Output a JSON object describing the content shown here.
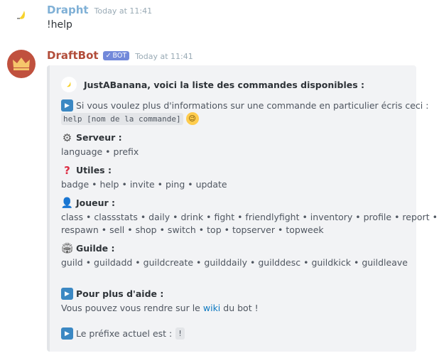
{
  "messages": [
    {
      "author": "Drapht",
      "timestamp": "Today at 11:41",
      "text": "!help",
      "avatar_icon": "banana-icon"
    },
    {
      "author": "DraftBot",
      "bot_tag": "BOT",
      "timestamp": "Today at 11:41",
      "avatar_icon": "crown-icon"
    }
  ],
  "embed": {
    "author": "JustABanana, voici la liste des commandes disponibles :",
    "intro": "Si vous voulez plus d'informations sur une commande en particulier écris ceci :",
    "intro_code": "help [nom de la commande]",
    "sections": [
      {
        "icon": "gear-icon",
        "title": "Serveur :",
        "commands": "language • prefix"
      },
      {
        "icon": "question-icon",
        "title": "Utiles :",
        "commands": "badge • help • invite • ping • update"
      },
      {
        "icon": "user-icon",
        "title": "Joueur :",
        "commands": "class • classstats • daily • drink • fight • friendlyfight • inventory • profile • report •",
        "commands_2": "respawn • sell • shop • switch • top • topserver • topweek"
      },
      {
        "icon": "stadium-icon",
        "title": "Guilde :",
        "commands": "guild • guildadd • guildcreate • guilddaily • guilddesc • guildkick • guildleave"
      }
    ],
    "help_title": "Pour plus d'aide :",
    "help_text_before": "Vous pouvez vous rendre sur le",
    "help_link": "wiki",
    "help_text_after": "du bot !",
    "prefix_text": "Le préfixe actuel est :",
    "prefix_code": "!"
  },
  "colors": {
    "drapht_name": "#7fb0d6",
    "draftbot_name": "#b24d3a",
    "bot_tag": "#7289da",
    "link": "#0b78c1",
    "embed_bg": "#f2f3f5"
  }
}
